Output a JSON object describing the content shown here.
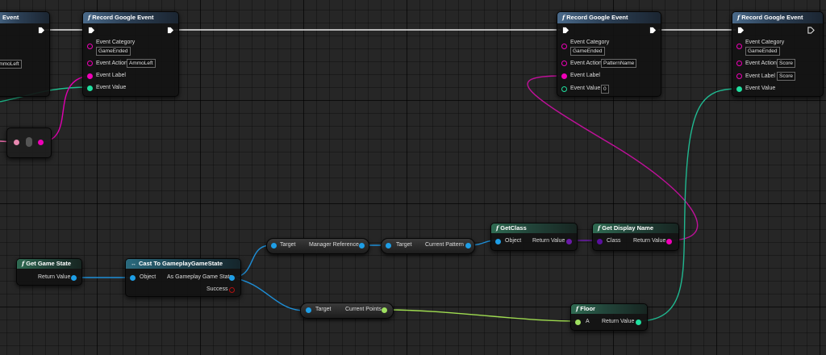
{
  "nodes": {
    "left_partial": {
      "title": "Event",
      "action_value": "AmmoLeft"
    },
    "record_event_1": {
      "title": "Record Google Event",
      "category_label": "Event Category",
      "category_value": "GameEnded",
      "action_label": "Event Action",
      "action_value": "AmmoLeft",
      "label_label": "Event Label",
      "value_label": "Event Value"
    },
    "record_event_2": {
      "title": "Record Google Event",
      "category_label": "Event Category",
      "category_value": "GameEnded",
      "action_label": "Event Action",
      "action_value": "PatternName",
      "label_label": "Event Label",
      "value_label": "Event Value",
      "value_value": "0"
    },
    "record_event_3": {
      "title": "Record Google Event",
      "category_label": "Event Category",
      "category_value": "GameEnded",
      "action_label": "Event Action",
      "action_value": "Score",
      "label_label": "Event Label",
      "label_value": "Score",
      "value_label": "Event Value"
    },
    "get_game_state": {
      "title": "Get Game State",
      "return_label": "Return Value"
    },
    "cast_node": {
      "title": "Cast To GameplayGameState",
      "object_label": "Object",
      "as_label": "As Gameplay Game State",
      "success_label": "Success"
    },
    "manager_ref": {
      "target_label": "Target",
      "output_label": "Manager Reference"
    },
    "current_pattern": {
      "target_label": "Target",
      "output_label": "Current Pattern"
    },
    "current_points": {
      "target_label": "Target",
      "output_label": "Current Points"
    },
    "get_class": {
      "title": "GetClass",
      "object_label": "Object",
      "return_label": "Return Value"
    },
    "get_display_name": {
      "title": "Get Display Name",
      "class_label": "Class",
      "return_label": "Return Value"
    },
    "floor": {
      "title": "Floor",
      "a_label": "A",
      "return_label": "Return Value"
    }
  },
  "colors": {
    "exec_wire": "#ffffff",
    "string_pin": "#f000b8",
    "int_pin": "#20e0a0",
    "object_pin": "#1e9ee6",
    "class_pin": "#6a1aa8",
    "float_pin": "#a8e04a"
  }
}
